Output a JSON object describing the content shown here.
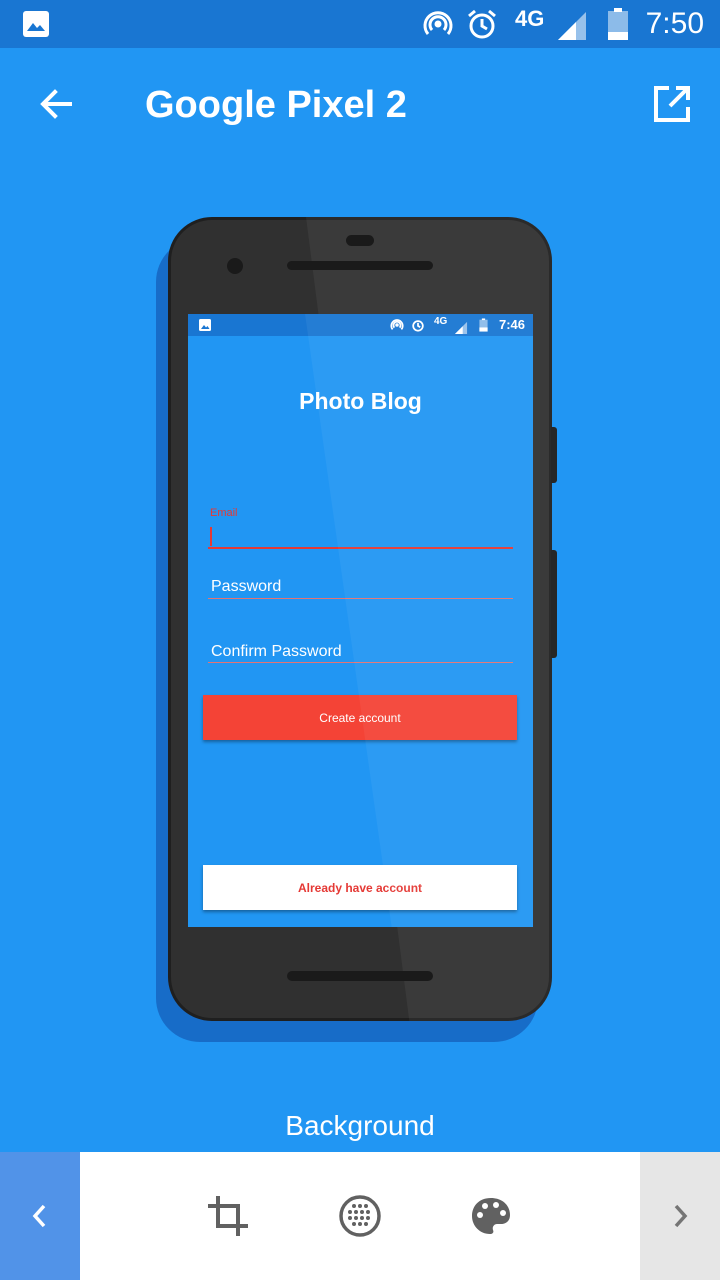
{
  "status_bar": {
    "network": "4G",
    "time": "7:50",
    "icons": [
      "image-icon",
      "hotspot-icon",
      "alarm-icon",
      "signal-icon",
      "battery-icon"
    ]
  },
  "toolbar": {
    "title": "Google Pixel 2",
    "back_icon": "arrow-back-icon",
    "open_icon": "open-in-new-icon"
  },
  "device_screen": {
    "status_bar": {
      "network": "4G",
      "time": "7:46"
    },
    "app_title": "Photo Blog",
    "email_label": "Email",
    "password_placeholder": "Password",
    "confirm_password_placeholder": "Confirm Password",
    "create_button": "Create account",
    "login_button": "Already have account"
  },
  "bottom": {
    "section_label": "Background",
    "tools": [
      "crop-icon",
      "grid-icon",
      "palette-icon"
    ],
    "prev_icon": "chevron-left-icon",
    "next_icon": "chevron-right-icon"
  },
  "colors": {
    "primary": "#2196F3",
    "status_bar": "#1976D2",
    "accent_red": "#F44336",
    "phone_body": "#303030"
  }
}
